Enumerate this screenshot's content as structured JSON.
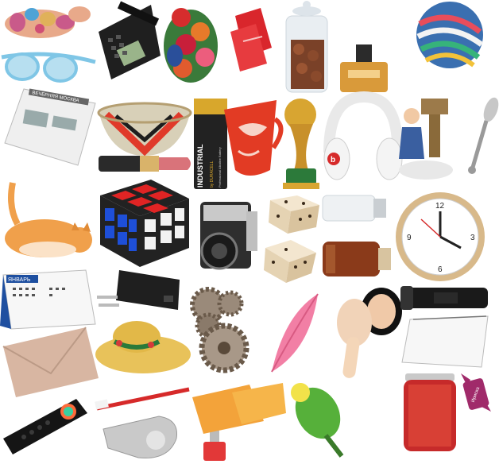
{
  "scene": {
    "description_items": [
      "brooch",
      "sunglasses",
      "desk-phone",
      "flowers",
      "red-cards",
      "cookie-jar",
      "perfume",
      "marble-ball",
      "newspaper",
      "woven-basket",
      "battery",
      "red-cup",
      "world-cup-trophy",
      "headphones",
      "figurine",
      "spoon",
      "lipstick",
      "cat",
      "rubiks-cube",
      "camera",
      "dice",
      "vial",
      "brown-bottle",
      "wall-clock",
      "desk-calendar",
      "charger",
      "gears",
      "feather",
      "compact-powder",
      "flashlight",
      "notepad",
      "straw-hat",
      "envelope",
      "jam-jar",
      "candy",
      "remote-control",
      "toothbrush",
      "whistle",
      "nail-polish",
      "sponge-cloths",
      "parakeet"
    ]
  },
  "texts": {
    "newspaper_header": "ВЕЧЕРНЯЯ МОСКВА",
    "battery_brand": "INDUSTRIAL",
    "battery_brand2": "by DURACELL",
    "battery_sub": "Professional Alkaline Battery",
    "calendar_month": "ЯНВАРЬ",
    "headphones_logo": "b",
    "candy_label": "Ириска"
  },
  "colors": {
    "background": "#ffffff",
    "cube_red": "#e02424",
    "cube_blue": "#1e4fd8",
    "cube_white": "#f2f2f2",
    "cup_red": "#e23b24",
    "cat_orange": "#f0a04b",
    "feather_pink": "#f27fa5",
    "bird_green": "#56b03a",
    "sponge_orange": "#f3a33a",
    "envelope": "#d8b6a2"
  }
}
